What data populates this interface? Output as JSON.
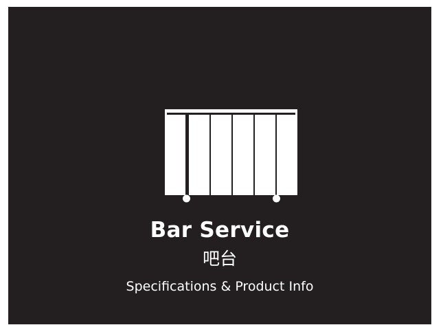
{
  "card": {
    "title": "Bar Service",
    "title_cn": "吧台",
    "link_label": "Specifications & Product Info",
    "icon": "bar-counter-icon"
  },
  "colors": {
    "background": "#231f20",
    "foreground": "#ffffff"
  }
}
